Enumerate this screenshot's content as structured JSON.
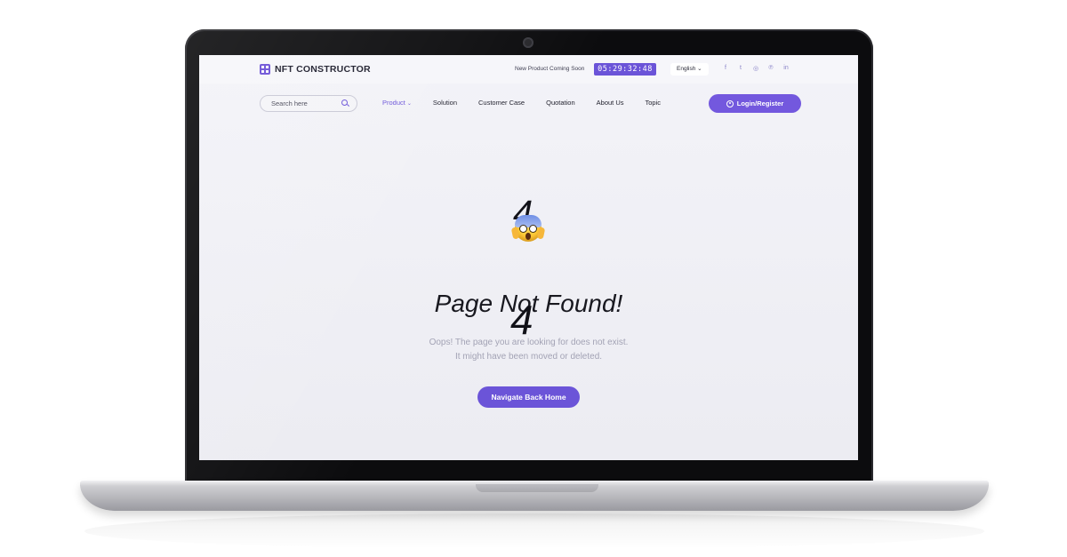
{
  "header": {
    "logo_text": "NFT CONSTRUCTOR",
    "coming_soon": "New Product Coming Soon",
    "countdown": "05:29:32:48",
    "language": "English",
    "language_chevron": "⌄",
    "socials": [
      {
        "name": "facebook-icon",
        "glyph": "f"
      },
      {
        "name": "twitter-icon",
        "glyph": "t"
      },
      {
        "name": "instagram-icon",
        "glyph": "◎"
      },
      {
        "name": "pinterest-icon",
        "glyph": "℗"
      },
      {
        "name": "linkedin-icon",
        "glyph": "in"
      }
    ]
  },
  "nav": {
    "search_placeholder": "Search here",
    "items": [
      {
        "label": "Product",
        "active": true,
        "chevron": "⌄"
      },
      {
        "label": "Solution"
      },
      {
        "label": "Customer Case"
      },
      {
        "label": "Quotation"
      },
      {
        "label": "About Us"
      },
      {
        "label": "Topic"
      }
    ],
    "login_label": "Login/Register"
  },
  "error": {
    "digit_top": "4",
    "digit_mid": "4",
    "title": "Page Not Found!",
    "message_line1": "Oops! The page you are looking for does not exist.",
    "message_line2": "It might have been moved or deleted.",
    "button_label": "Navigate Back Home"
  },
  "colors": {
    "accent": "#6b54d8",
    "text_muted": "#a3a3b5",
    "bezel": "#0c0c0e"
  }
}
